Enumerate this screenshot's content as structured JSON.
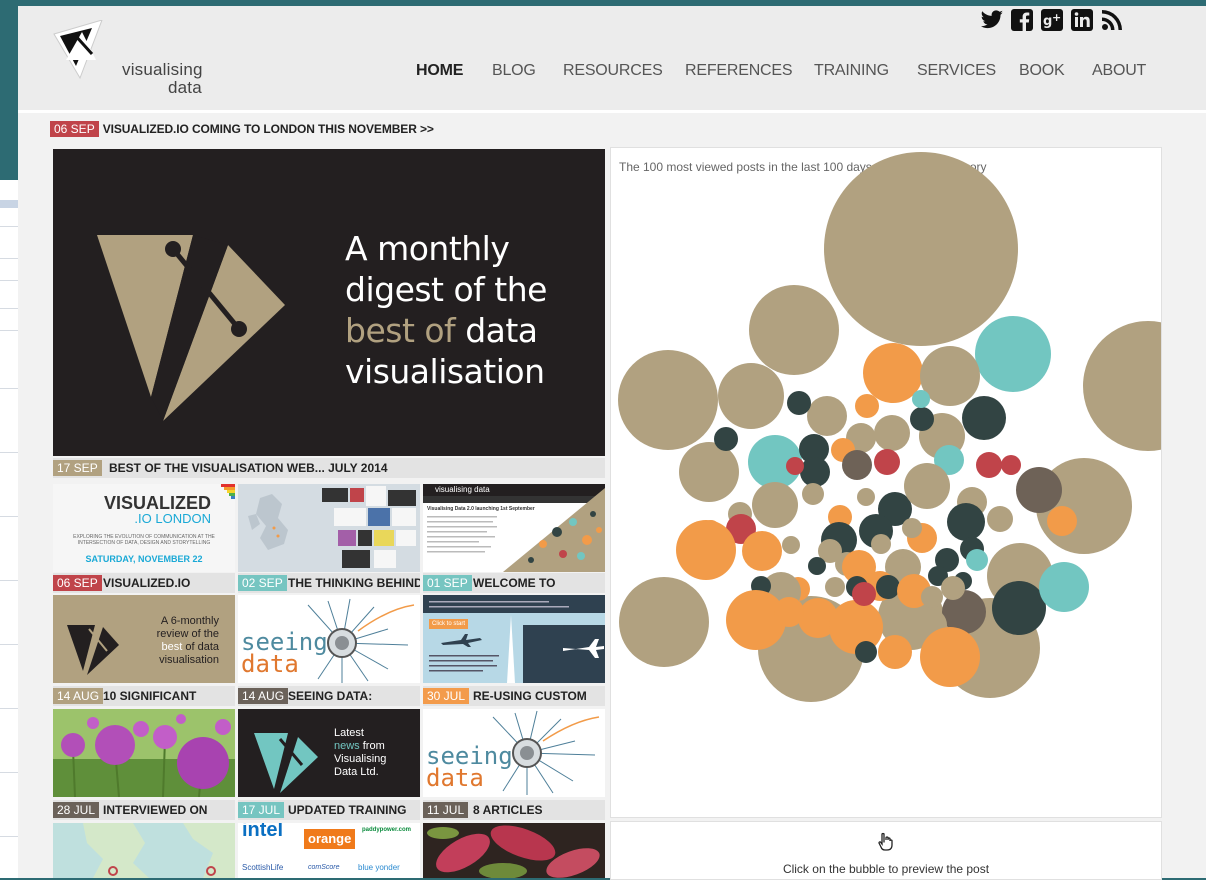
{
  "site": {
    "logo_line1": "visualising",
    "logo_line2": "data"
  },
  "social_icons": [
    "twitter-icon",
    "facebook-icon",
    "google-plus-icon",
    "linkedin-icon",
    "rss-icon"
  ],
  "nav": [
    {
      "label": "HOME",
      "active": true
    },
    {
      "label": "BLOG",
      "active": false
    },
    {
      "label": "RESOURCES",
      "active": false
    },
    {
      "label": "REFERENCES",
      "active": false
    },
    {
      "label": "TRAINING",
      "active": false
    },
    {
      "label": "SERVICES",
      "active": false
    },
    {
      "label": "BOOK",
      "active": false
    },
    {
      "label": "ABOUT",
      "active": false
    }
  ],
  "ticker": {
    "date": "06 SEP",
    "text": "VISUALIZED.IO COMING TO LONDON THIS NOVEMBER >>"
  },
  "feature": {
    "lines": [
      "A monthly",
      "digest of the",
      "best of",
      "data",
      "visualisation"
    ],
    "caption": {
      "date": "17 SEP",
      "text": "BEST OF THE VISUALISATION WEB... JULY 2014"
    }
  },
  "thumbs": {
    "visualized": {
      "title1": "VISUALIZED",
      "title2": ".IO LONDON",
      "tagline": "EXPLORING THE EVOLUTION OF COMMUNICATION AT THE INTERSECTION OF DATA, DESIGN AND STORYTELLING",
      "date_line": "SATURDAY, NOVEMBER 22"
    },
    "welcome": {
      "banner": "visualising data",
      "heading": "Visualising Data 2.0 launching 1st September"
    },
    "review": {
      "text1": "A 6-monthly",
      "text2": "review of the",
      "text3": "best",
      "text4": "of data",
      "text5": "visualisation"
    },
    "seeing1": {
      "word1": "seeing",
      "word2": "data"
    },
    "seeing2": {
      "word1": "seeing",
      "word2": "data"
    },
    "news": {
      "l1": "Latest",
      "l2": "news",
      "l3": "from",
      "l4": "Visualising",
      "l5": "Data Ltd."
    },
    "custom": {
      "label": "Click to start"
    },
    "logos": {
      "l1": "intel",
      "l2": "orange",
      "l3": "paddypower.com",
      "l4": "ScottishLife",
      "l5": "comScore",
      "l6": "blue yonder"
    }
  },
  "captions": [
    {
      "date": "06 SEP",
      "text": "VISUALIZED.IO",
      "color": "#c0444a"
    },
    {
      "date": "02 SEP",
      "text": "THE THINKING BEHIND",
      "color": "#76c5c1"
    },
    {
      "date": "01 SEP",
      "text": "WELCOME TO",
      "color": "#76c5c1"
    },
    {
      "date": "14 AUG",
      "text": "10 SIGNIFICANT",
      "color": "#b4a282"
    },
    {
      "date": "14 AUG",
      "text": "SEEING DATA:",
      "color": "#6b625a"
    },
    {
      "date": "30 JUL",
      "text": "RE-USING CUSTOM",
      "color": "#f39b4b"
    },
    {
      "date": "28 JUL",
      "text": "INTERVIEWED ON",
      "color": "#6b625a"
    },
    {
      "date": "17 JUL",
      "text": "UPDATED TRAINING",
      "color": "#76c5c1"
    },
    {
      "date": "11 JUL",
      "text": "8 ARTICLES",
      "color": "#6b625a"
    }
  ],
  "bubbles": {
    "title": "The 100 most viewed posts in the last 100 days coloured by category",
    "hint": "Click on the bubble to preview the post",
    "colors": {
      "tan": "#b1a180",
      "orange": "#f29b49",
      "teal": "#72c6c1",
      "dark": "#324443",
      "red": "#c0444a",
      "brown": "#6e6257"
    }
  }
}
